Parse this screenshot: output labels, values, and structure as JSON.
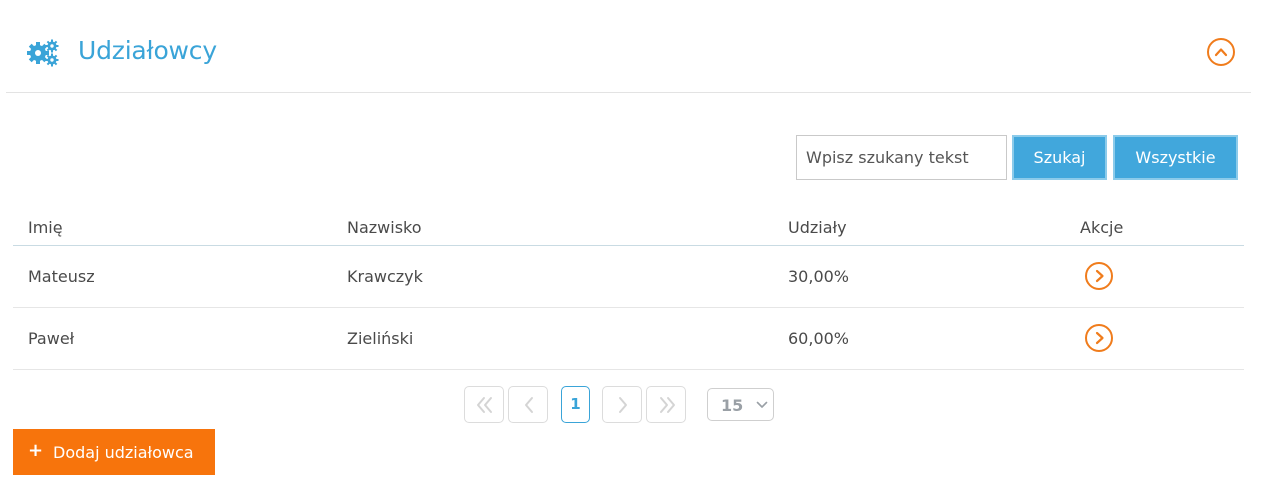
{
  "panel": {
    "title": "Udziałowcy",
    "header_icon": "gears-icon",
    "collapse_icon": "chevron-up-icon"
  },
  "search": {
    "placeholder": "Wpisz szukany tekst",
    "value": "",
    "search_button": "Szukaj",
    "all_button": "Wszystkie"
  },
  "table": {
    "columns": [
      "Imię",
      "Nazwisko",
      "Udziały",
      "Akcje"
    ],
    "rows": [
      {
        "first_name": "Mateusz",
        "last_name": "Krawczyk",
        "shares": "30,00%",
        "action_icon": "chevron-right-circle-icon"
      },
      {
        "first_name": "Paweł",
        "last_name": "Zieliński",
        "shares": "60,00%",
        "action_icon": "chevron-right-circle-icon"
      }
    ]
  },
  "pagination": {
    "first_icon": "double-chevron-left-icon",
    "prev_icon": "chevron-left-icon",
    "current_page": "1",
    "next_icon": "chevron-right-icon",
    "last_icon": "double-chevron-right-icon",
    "page_size": "15"
  },
  "add_button": {
    "icon": "+",
    "label": "Dodaj udziałowca"
  },
  "colors": {
    "accent_blue": "#3aa4d8",
    "accent_orange": "#f7740c"
  }
}
